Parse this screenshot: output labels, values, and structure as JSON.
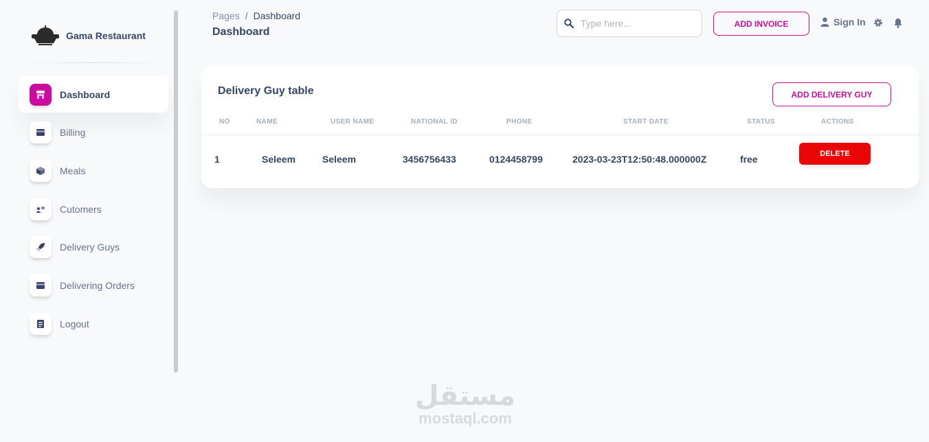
{
  "brand": {
    "name": "Gama Restaurant",
    "logo_text": "RESTAURANT"
  },
  "sidebar": {
    "items": [
      {
        "label": "Dashboard",
        "icon": "shop-icon",
        "active": true
      },
      {
        "label": "Billing",
        "icon": "credit-card-icon",
        "active": false
      },
      {
        "label": "Meals",
        "icon": "box-3d-icon",
        "active": false
      },
      {
        "label": "Cutomers",
        "icon": "users-icon",
        "active": false
      },
      {
        "label": "Delivery Guys",
        "icon": "rocket-icon",
        "active": false
      },
      {
        "label": "Delivering Orders",
        "icon": "credit-card-icon",
        "active": false
      },
      {
        "label": "Logout",
        "icon": "document-icon",
        "active": false
      }
    ]
  },
  "header": {
    "breadcrumb": {
      "root": "Pages",
      "separator": "/",
      "current": "Dashboard"
    },
    "title": "Dashboard",
    "search": {
      "placeholder": "Type here...",
      "value": ""
    },
    "add_invoice_label": "ADD INVOICE",
    "signin_label": "Sign In"
  },
  "card": {
    "title": "Delivery Guy table",
    "add_button_label": "ADD DELIVERY GUY",
    "columns": [
      "NO",
      "NAME",
      "USER NAME",
      "NATIONAL ID",
      "PHONE",
      "START DATE",
      "STATUS",
      "ACTIONS"
    ],
    "rows": [
      {
        "no": "1",
        "name": "Seleem",
        "username": "Seleem",
        "national_id": "3456756433",
        "phone": "0124458799",
        "start_date": "2023-03-23T12:50:48.000000Z",
        "status": "free",
        "action_label": "DELETE"
      }
    ]
  },
  "watermark": {
    "arabic": "مستقل",
    "latin": "mostaql.com"
  },
  "colors": {
    "accent": "#cb0c9f",
    "danger": "#ea0606",
    "text": "#344767",
    "muted": "#67748e"
  }
}
